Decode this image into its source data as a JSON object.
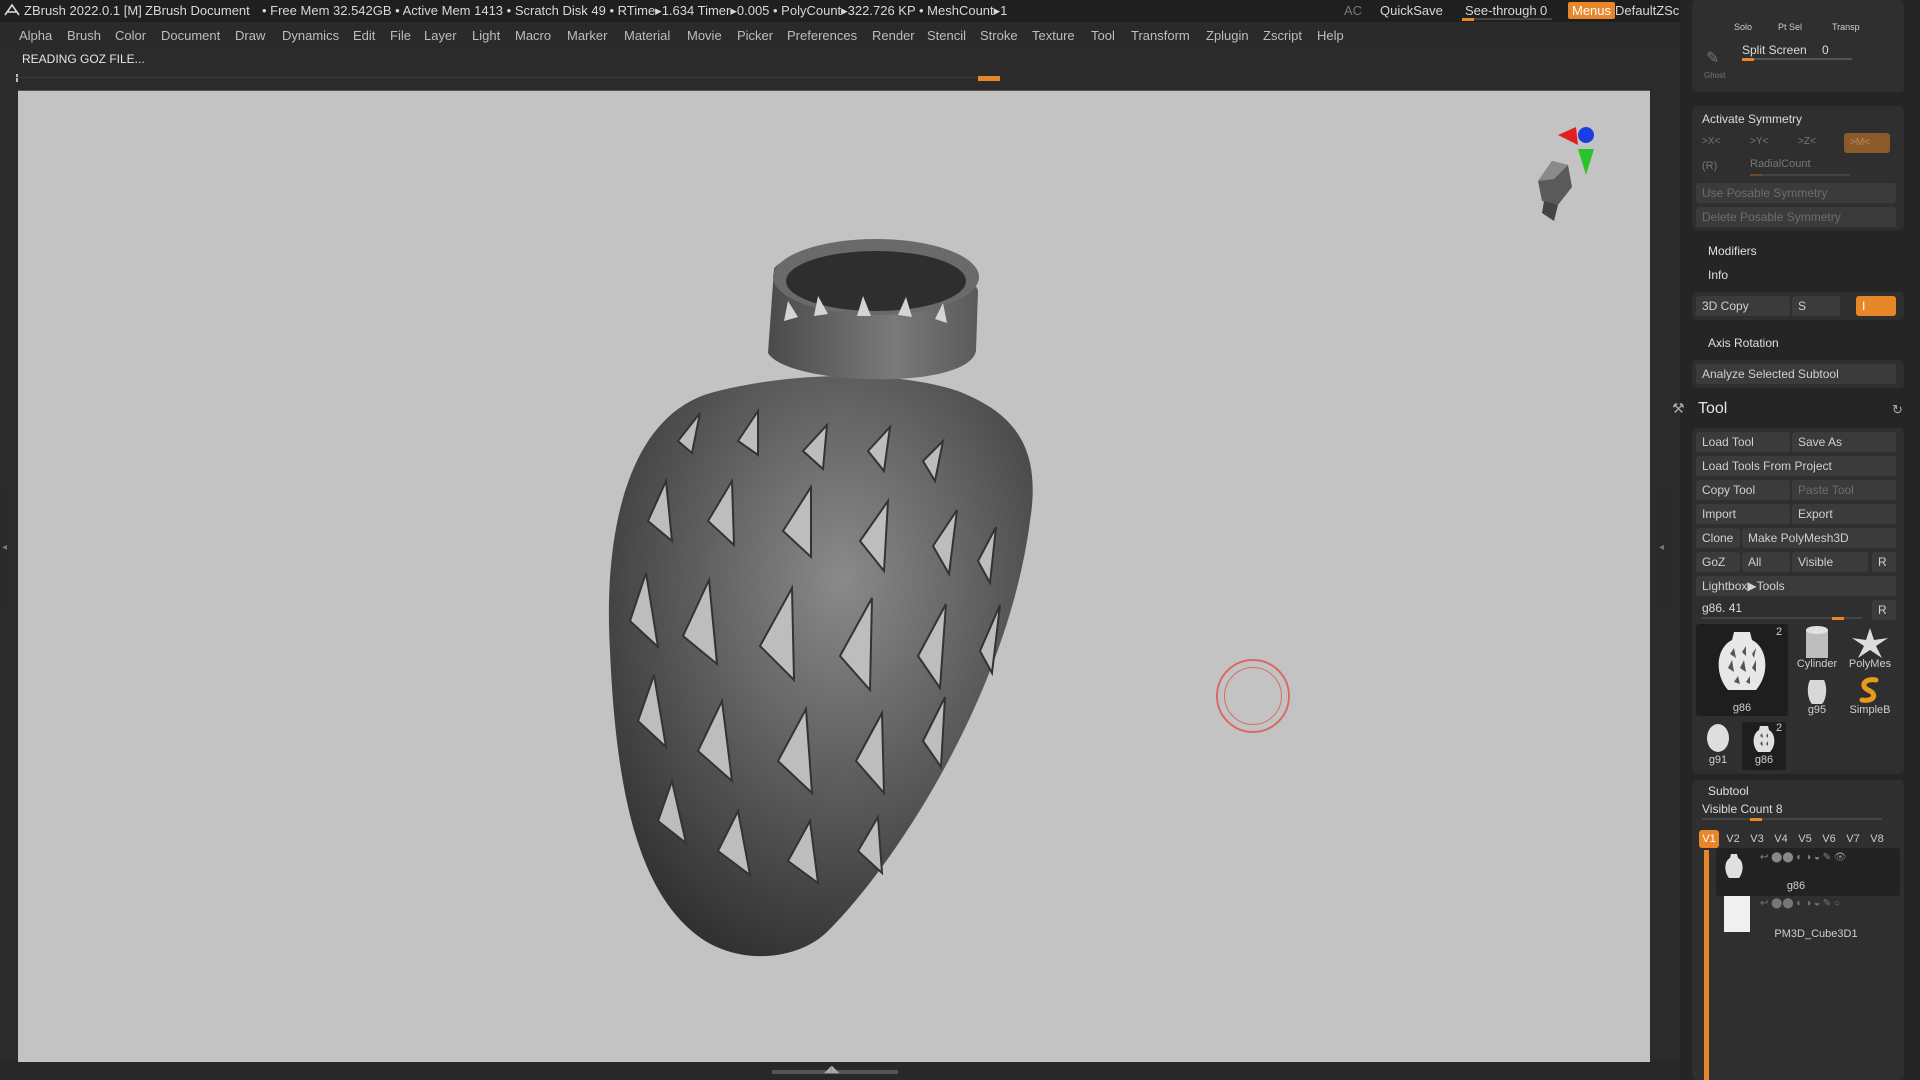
{
  "titlebar": {
    "app": "ZBrush 2022.0.1 [M]",
    "document": "ZBrush Document",
    "stats": "• Free Mem 32.542GB • Active Mem 1413 • Scratch Disk 49 •  RTime▸1.634 Timer▸0.005 • PolyCount▸322.726 KP • MeshCount▸1",
    "ac": "AC",
    "quicksave": "QuickSave",
    "seethrough": "See-through",
    "seethrough_value": "0",
    "menus": "Menus",
    "script": "DefaultZScript"
  },
  "menu": [
    "Alpha",
    "Brush",
    "Color",
    "Document",
    "Draw",
    "Dynamics",
    "Edit",
    "File",
    "Layer",
    "Light",
    "Macro",
    "Marker",
    "Material",
    "Movie",
    "Picker",
    "Preferences",
    "Render",
    "Stencil",
    "Stroke",
    "Texture",
    "Tool",
    "Transform",
    "Zplugin",
    "Zscript",
    "Help"
  ],
  "status": "READING GOZ FILE...",
  "panel": {
    "solo": "Solo",
    "ptsel": "Pt Sel",
    "transp": "Transp",
    "ghost": "Ghost",
    "split_screen": "Split Screen",
    "split_value": "0",
    "activate_symmetry": "Activate Symmetry",
    "sym_x": ">X<",
    "sym_y": ">Y<",
    "sym_z": ">Z<",
    "sym_m": ">M<",
    "sym_r": "(R)",
    "radial_count": "RadialCount",
    "use_posable": "Use Posable Symmetry",
    "delete_posable": "Delete Posable Symmetry",
    "modifiers": "Modifiers",
    "info": "Info",
    "copy3d": "3D Copy",
    "copy3d_s": "S",
    "copy3d_i": "I",
    "axis_rotation": "Axis Rotation",
    "analyze": "Analyze Selected Subtool",
    "tool_title": "Tool",
    "load_tool": "Load Tool",
    "save_as": "Save As",
    "load_from_project": "Load Tools From Project",
    "copy_tool": "Copy Tool",
    "paste_tool": "Paste Tool",
    "import": "Import",
    "export": "Export",
    "clone": "Clone",
    "make_polymesh": "Make PolyMesh3D",
    "goz": "GoZ",
    "all": "All",
    "visible": "Visible",
    "r": "R",
    "lightbox_tools": "Lightbox▶Tools",
    "current_tool": "g86. 41",
    "tools": [
      {
        "name": "g86",
        "badge": "2"
      },
      {
        "name": "Cylinder"
      },
      {
        "name": "PolyMes"
      },
      {
        "name": "g95"
      },
      {
        "name": "SimpleB"
      },
      {
        "name": "g91"
      },
      {
        "name": "g86",
        "badge": "2"
      }
    ],
    "subtool": "Subtool",
    "visible_count": "Visible Count 8",
    "vtabs": [
      "V1",
      "V2",
      "V3",
      "V4",
      "V5",
      "V6",
      "V7",
      "V8"
    ],
    "subtools": [
      "g86",
      "PM3D_Cube3D1"
    ]
  },
  "colors": {
    "accent": "#e8872a",
    "viewport": "#c3c3c3",
    "panel": "#252525"
  }
}
